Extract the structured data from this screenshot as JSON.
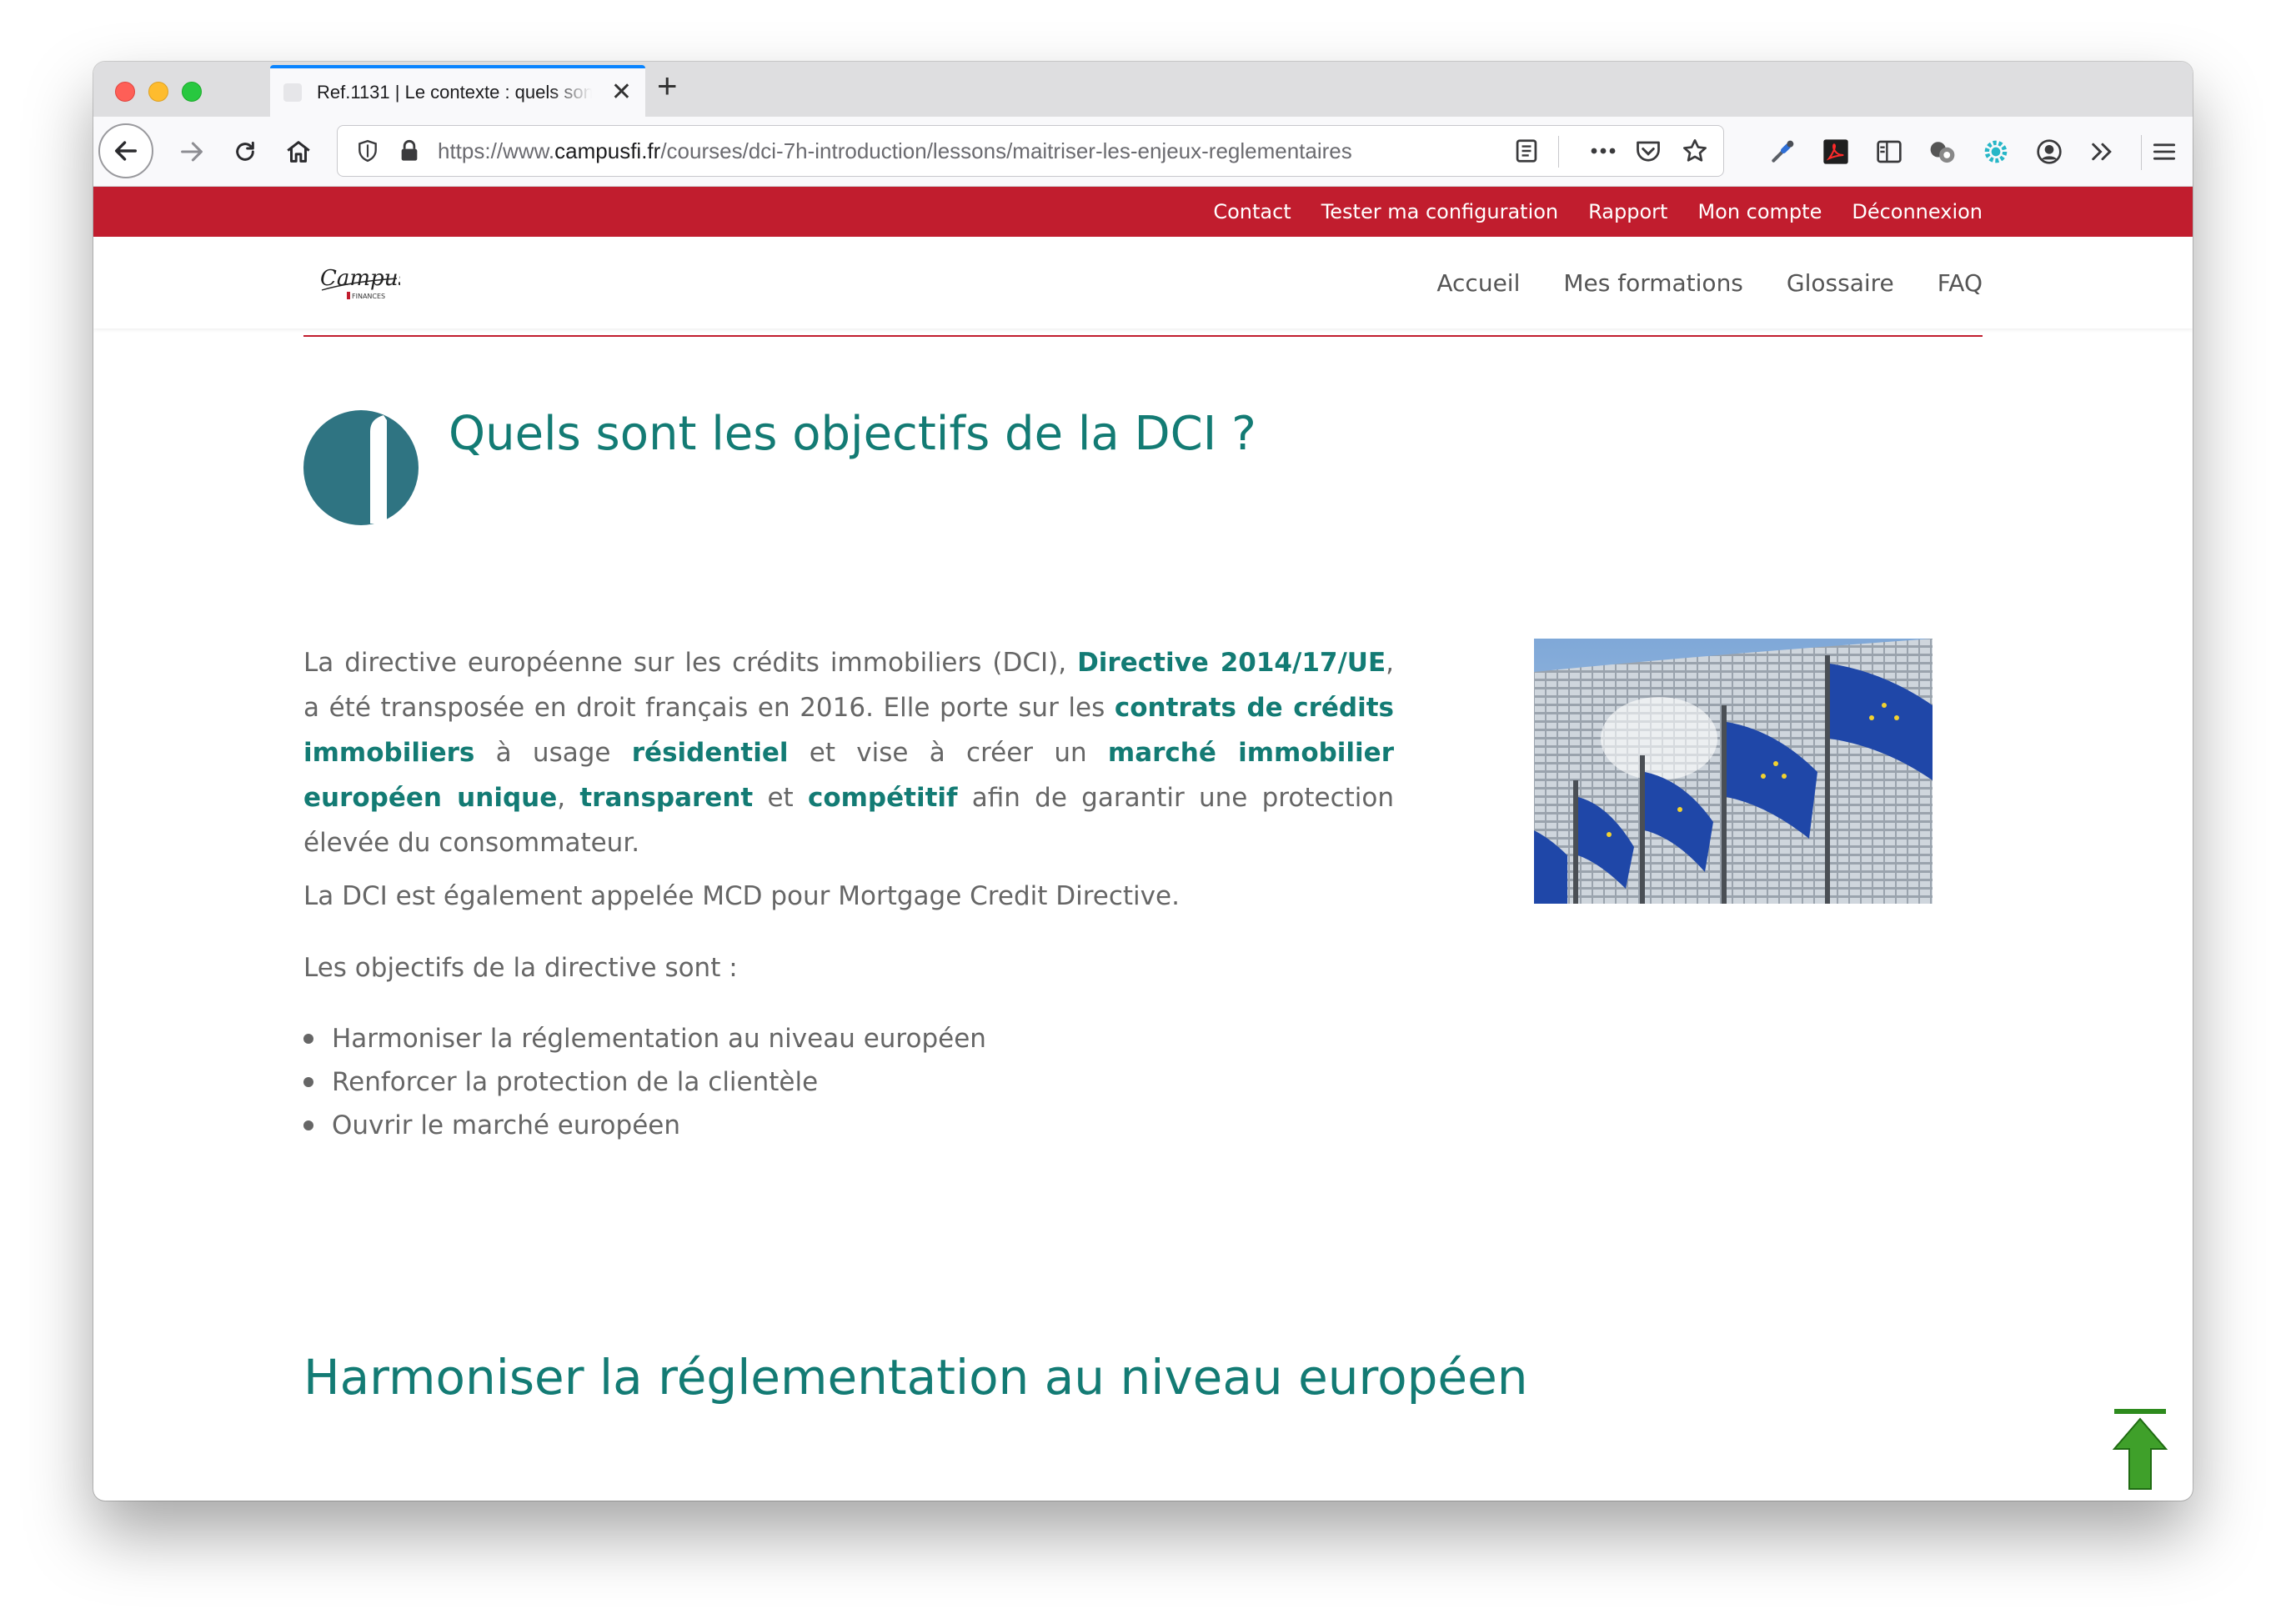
{
  "browser": {
    "tab_title": "Ref.1131 | Le contexte : quels sont les objectifs de la DCI",
    "url_prefix": "https://www.",
    "url_domain": "campusfi.fr",
    "url_path": "/courses/dci-7h-introduction/lessons/maitriser-les-enjeux-reglementaires"
  },
  "topbar": {
    "links": [
      "Contact",
      "Tester ma configuration",
      "Rapport",
      "Mon compte",
      "Déconnexion"
    ],
    "background_color": "#c11d2e"
  },
  "header": {
    "logo_text": "Campus",
    "logo_subtext": "FINANCES",
    "nav": [
      "Accueil",
      "Mes formations",
      "Glossaire",
      "FAQ"
    ]
  },
  "content": {
    "title": "Quels sont les objectifs de la DCI ?",
    "paragraph1": [
      {
        "text": "La directive européenne sur les crédits immobiliers (DCI), ",
        "bold": false
      },
      {
        "text": "Directive 2014/17/UE",
        "bold": true
      },
      {
        "text": ", a été transposée en droit français en 2016. Elle porte sur les ",
        "bold": false
      },
      {
        "text": "contrats de crédits immobiliers",
        "bold": true
      },
      {
        "text": " à usage ",
        "bold": false
      },
      {
        "text": "résidentiel",
        "bold": true
      },
      {
        "text": " et vise à créer un ",
        "bold": false
      },
      {
        "text": "marché immobilier européen unique",
        "bold": true
      },
      {
        "text": ", ",
        "bold": false
      },
      {
        "text": "transparent",
        "bold": true
      },
      {
        "text": " et ",
        "bold": false
      },
      {
        "text": "compétitif",
        "bold": true
      },
      {
        "text": " afin de garantir une protection élevée du consommateur.",
        "bold": false
      }
    ],
    "paragraph2": "La DCI est également appelée MCD pour Mortgage Credit Directive.",
    "paragraph3": "Les objectifs de la directive sont :",
    "objectives": [
      "Harmoniser la réglementation au niveau européen",
      "Renforcer la protection de la clientèle",
      "Ouvrir le marché européen"
    ],
    "section_heading": "Harmoniser la réglementation au niveau européen",
    "accent_color": "#137b74"
  }
}
